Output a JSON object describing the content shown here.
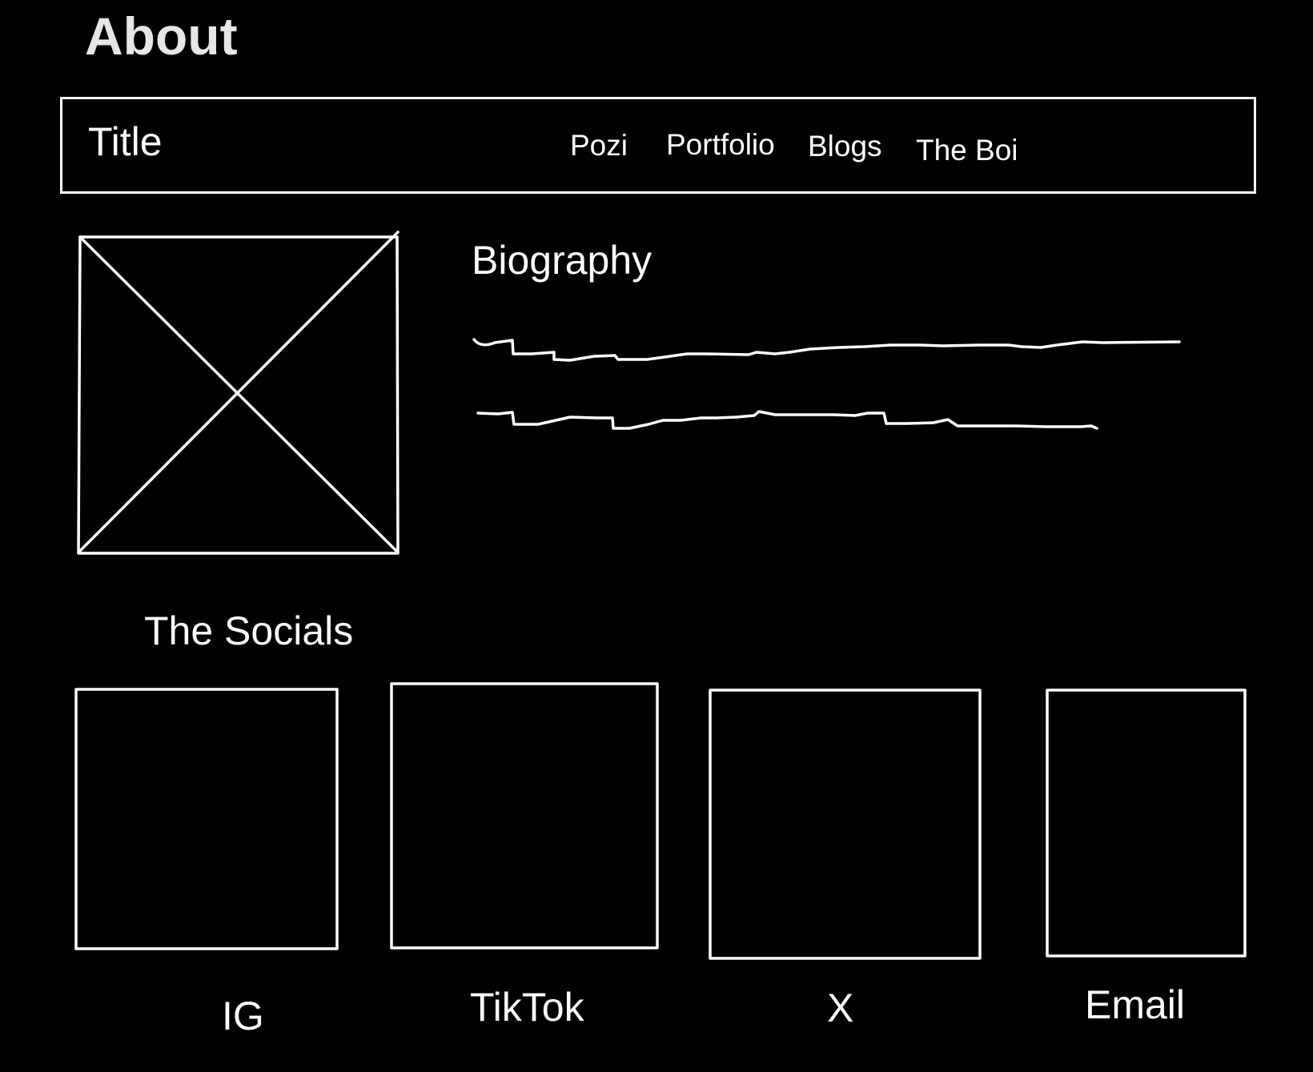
{
  "page": {
    "heading": "About"
  },
  "navbar": {
    "brand": "Title",
    "links": [
      "Pozi",
      "Portfolio",
      "Blogs",
      "The Boi"
    ]
  },
  "profile": {
    "image": "image-placeholder-icon"
  },
  "biography": {
    "heading": "Biography",
    "text_lines": "squiggle-text-placeholder"
  },
  "socials": {
    "heading": "The Socials",
    "items": [
      {
        "label": "IG"
      },
      {
        "label": "TikTok"
      },
      {
        "label": "X"
      },
      {
        "label": "Email"
      }
    ]
  },
  "colors": {
    "background": "#000000",
    "stroke": "#ffffff",
    "heading": "#e6e6e6"
  }
}
